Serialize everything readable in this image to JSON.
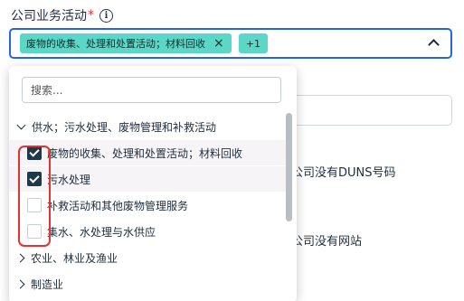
{
  "field": {
    "label": "公司业务活动",
    "required_mark": "*",
    "info_glyph": "i"
  },
  "select": {
    "tag_label": "废物的收集、处理和处置活动；材料回收",
    "tag_remove": "×",
    "more_label": "+1"
  },
  "dropdown": {
    "search_placeholder": "搜索...",
    "group_open": "供水；污水处理、废物管理和补救活动",
    "options": [
      {
        "label": "废物的收集、处理和处置活动；材料回收",
        "checked": true
      },
      {
        "label": "污水处理",
        "checked": true
      },
      {
        "label": "补救活动和其他废物管理服务",
        "checked": false
      },
      {
        "label": "集水、水处理与水供应",
        "checked": false
      }
    ],
    "group_closed_1": "农业、林业及渔业",
    "group_closed_2": "制造业"
  },
  "background": {
    "duns_text": "公司没有DUNS号码",
    "website_text": "公司没有网站"
  },
  "colors": {
    "focus_border": "#2563eb",
    "tag_bg": "#5cd6c6",
    "checkbox_on": "#1e3a4a",
    "highlight": "#e3322f"
  }
}
